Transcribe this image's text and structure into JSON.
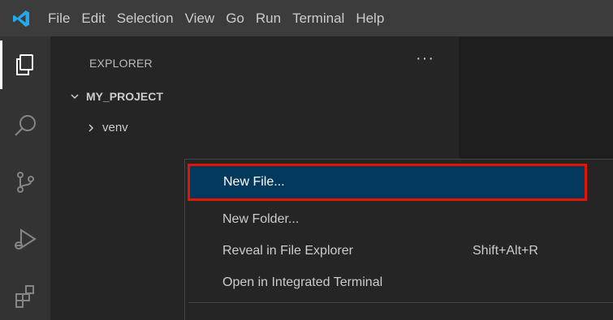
{
  "menubar": {
    "items": [
      "File",
      "Edit",
      "Selection",
      "View",
      "Go",
      "Run",
      "Terminal",
      "Help"
    ]
  },
  "activitybar": {
    "icons": [
      "files-icon",
      "search-icon",
      "source-control-icon",
      "run-debug-icon",
      "extensions-icon"
    ]
  },
  "sidebar": {
    "title": "EXPLORER",
    "more": "···",
    "project": "MY_PROJECT",
    "folder": "venv"
  },
  "context_menu": {
    "items": [
      {
        "label": "New File...",
        "shortcut": ""
      },
      {
        "label": "New Folder...",
        "shortcut": ""
      },
      {
        "label": "Reveal in File Explorer",
        "shortcut": "Shift+Alt+R"
      },
      {
        "label": "Open in Integrated Terminal",
        "shortcut": ""
      }
    ]
  },
  "colors": {
    "accent": "#007acc",
    "selection": "#04395e",
    "highlight_border": "#e51400"
  }
}
